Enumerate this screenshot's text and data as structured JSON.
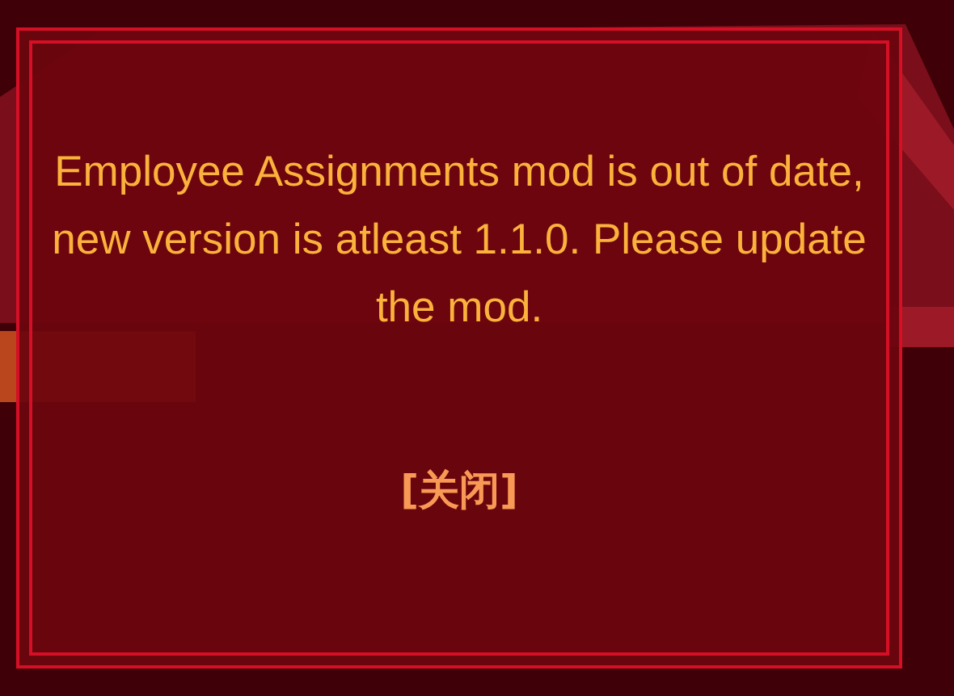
{
  "dialog": {
    "message": "Employee Assignments mod is out of date, new version is atleast 1.1.0. Please update the mod.",
    "close_button": "[关闭]"
  }
}
